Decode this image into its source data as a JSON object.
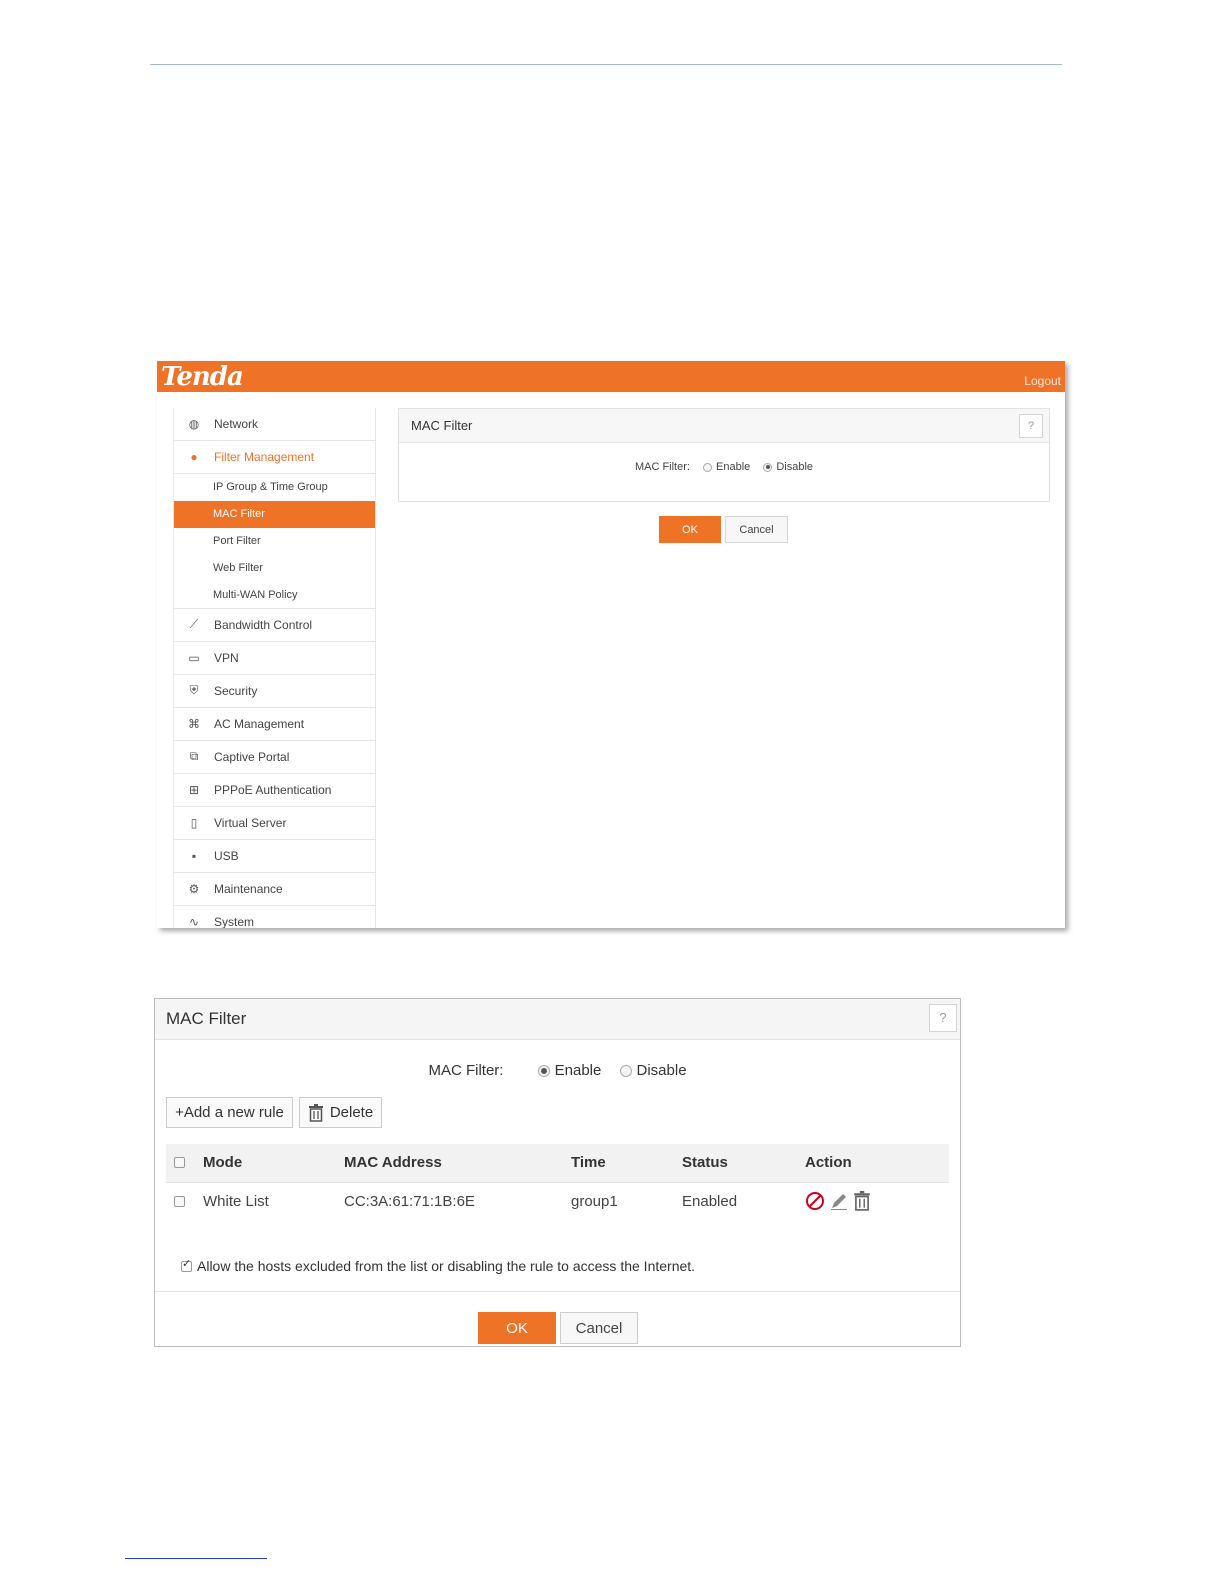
{
  "screenshot1": {
    "brand": "Tenda",
    "logout": "Logout",
    "sidebar": {
      "items": [
        {
          "label": "Network",
          "icon": "globe-icon",
          "glyph": "🌐"
        },
        {
          "label": "Filter Management",
          "icon": "filter-user-icon",
          "glyph": "👤"
        }
      ],
      "subitems": [
        "IP Group & Time Group",
        "MAC Filter",
        "Port Filter",
        "Web Filter",
        "Multi-WAN Policy"
      ],
      "items_after": [
        {
          "label": "Bandwidth Control",
          "icon": "bandwidth-icon",
          "glyph": "⟋"
        },
        {
          "label": "VPN",
          "icon": "vpn-icon",
          "glyph": "▭"
        },
        {
          "label": "Security",
          "icon": "shield-icon",
          "glyph": "⛨"
        },
        {
          "label": "AC Management",
          "icon": "ac-icon",
          "glyph": "⌘"
        },
        {
          "label": "Captive Portal",
          "icon": "portal-icon",
          "glyph": "⧉"
        },
        {
          "label": "PPPoE Authentication",
          "icon": "pppoe-icon",
          "glyph": "⊞"
        },
        {
          "label": "Virtual Server",
          "icon": "server-icon",
          "glyph": "▯"
        },
        {
          "label": "USB",
          "icon": "usb-icon",
          "glyph": "▪"
        },
        {
          "label": "Maintenance",
          "icon": "gear-icon",
          "glyph": "⚙"
        },
        {
          "label": "System",
          "icon": "pulse-icon",
          "glyph": "∿"
        }
      ]
    },
    "panel": {
      "title": "MAC Filter",
      "help": "?",
      "filter_label": "MAC Filter:",
      "enable": "Enable",
      "disable": "Disable",
      "selected": "Disable"
    },
    "ok": "OK",
    "cancel": "Cancel"
  },
  "screenshot2": {
    "title": "MAC Filter",
    "help": "?",
    "filter_label": "MAC Filter:",
    "enable": "Enable",
    "disable": "Disable",
    "selected": "Enable",
    "add_rule": "+Add a new rule",
    "delete": "Delete",
    "table": {
      "headers": [
        "Mode",
        "MAC Address",
        "Time",
        "Status",
        "Action"
      ],
      "rows": [
        {
          "mode": "White List",
          "mac": "CC:3A:61:71:1B:6E",
          "time": "group1",
          "status": "Enabled"
        }
      ]
    },
    "allow_text": "Allow the hosts excluded from the list or disabling the rule to access the Internet.",
    "allow_checked": true,
    "ok": "OK",
    "cancel": "Cancel",
    "colors": {
      "accent": "#ee7326",
      "disable_icon": "#d0021b"
    }
  }
}
